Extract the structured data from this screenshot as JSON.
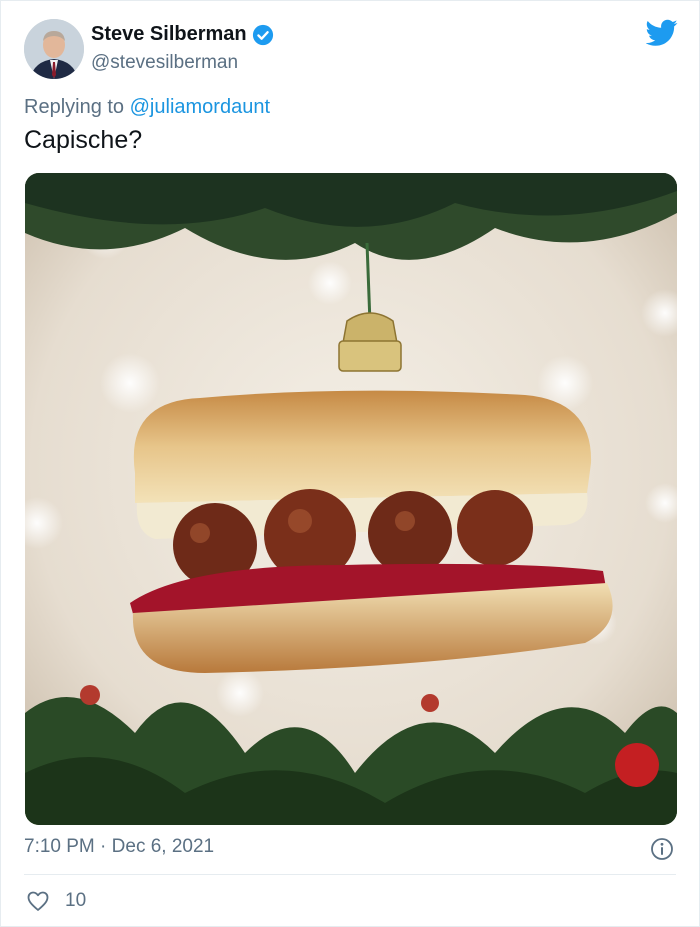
{
  "author": {
    "name": "Steve Silberman",
    "handle": "@stevesilberman"
  },
  "reply": {
    "prefix": "Replying to ",
    "to": "@juliamordaunt"
  },
  "text": "Capische?",
  "timestamp": {
    "time": "7:10 PM",
    "separator": "·",
    "date": "Dec 6, 2021"
  },
  "likes": {
    "count": "10"
  },
  "colors": {
    "accent": "#1b95e0",
    "muted": "#5b7083",
    "text": "#0f1419"
  },
  "icons": {
    "verified": "verified-badge-icon",
    "brand": "twitter-bird-icon",
    "info": "info-icon",
    "like": "heart-icon"
  }
}
